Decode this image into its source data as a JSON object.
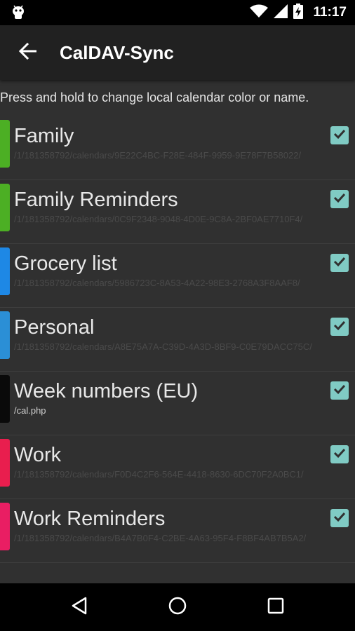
{
  "status_bar": {
    "time": "11:17",
    "icons": [
      "android-icon",
      "wifi-icon",
      "signal-icon",
      "battery-charging-icon"
    ]
  },
  "app_bar": {
    "title": "CalDAV-Sync",
    "back_icon": "arrow-left-icon"
  },
  "hint": "Press and hold to change local calendar color or name.",
  "calendars": [
    {
      "name": "Family",
      "subtitle": "/1/181358792/calendars/9E22C4BC-F28E-484F-9959-9E78F7B58022/",
      "color": "#4caf24",
      "checked": true,
      "subtitle_visible": false
    },
    {
      "name": "Family Reminders",
      "subtitle": "/1/181358792/calendars/0C9F2348-9048-4D0E-9C8A-2BF0AE7710F4/",
      "color": "#4caf24",
      "checked": true,
      "subtitle_visible": false
    },
    {
      "name": "Grocery list",
      "subtitle": "/1/181358792/calendars/5986723C-8A53-4A22-98E3-2768A3F8AAF8/",
      "color": "#1e88e5",
      "checked": true,
      "subtitle_visible": false
    },
    {
      "name": "Personal",
      "subtitle": "/1/181358792/calendars/A8E75A7A-C39D-4A3D-8BF9-C0E79DACC75C/",
      "color": "#2b8fd6",
      "checked": true,
      "subtitle_visible": false
    },
    {
      "name": "Week numbers (EU)",
      "subtitle": "/cal.php",
      "color": "#0a0a0a",
      "checked": true,
      "subtitle_visible": true
    },
    {
      "name": "Work",
      "subtitle": "/1/181358792/calendars/F0D4C2F6-564E-4418-8630-6DC70F2A0BC1/",
      "color": "#e91e4e",
      "checked": true,
      "subtitle_visible": false
    },
    {
      "name": "Work Reminders",
      "subtitle": "/1/181358792/calendars/B4A7B0F4-C2BE-4A63-95F4-F8BF4AB7B5A2/",
      "color": "#e91e63",
      "checked": true,
      "subtitle_visible": false
    }
  ],
  "nav_bar": {
    "icons": [
      "back-triangle-icon",
      "home-circle-icon",
      "recents-square-icon"
    ]
  },
  "colors": {
    "accent": "#80cbc4",
    "background": "#303030",
    "app_bar": "#212121"
  }
}
